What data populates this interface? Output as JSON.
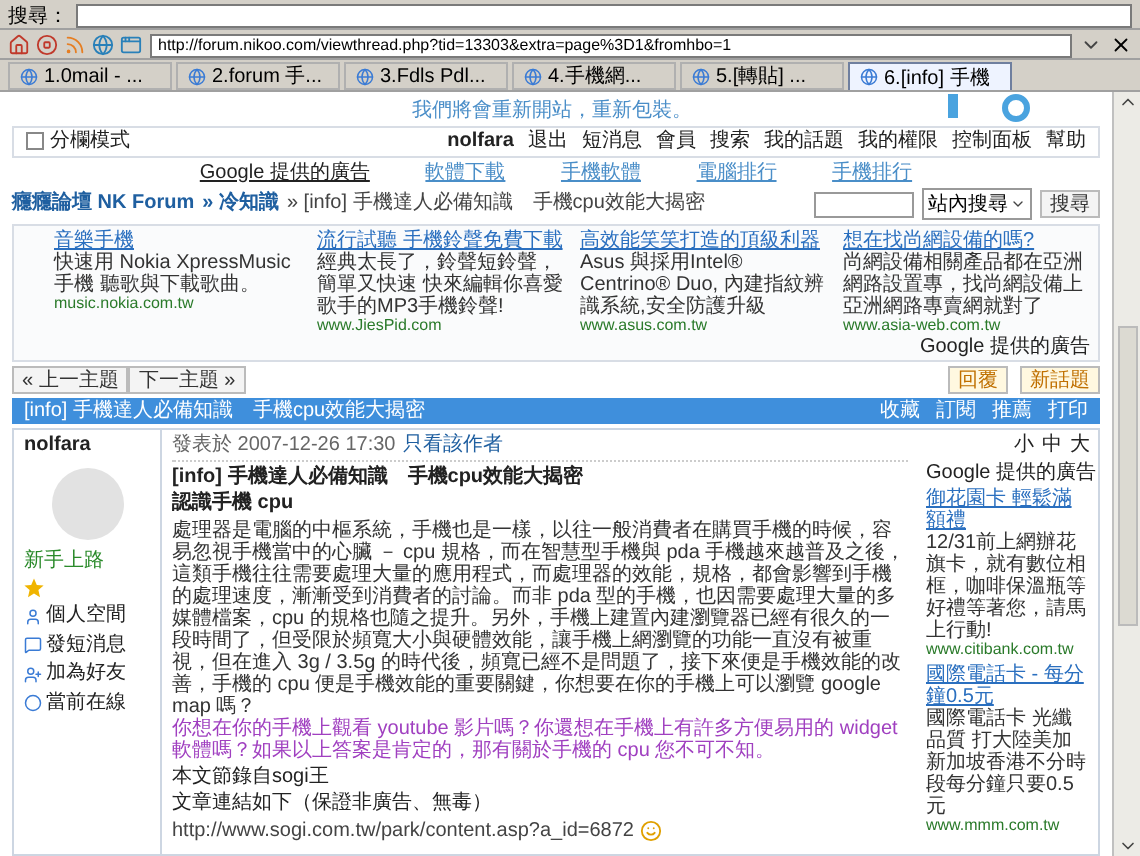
{
  "browser": {
    "search_label": "搜尋：",
    "address": "http://forum.nikoo.com/viewthread.php?tid=13303&extra=page%3D1&fromhbo=1",
    "tabs": [
      {
        "label": "1.0mail - ...",
        "selected": false
      },
      {
        "label": "2.forum 手...",
        "selected": false
      },
      {
        "label": "3.Fdls Pdl...",
        "selected": false
      },
      {
        "label": "4.手機網...",
        "selected": false
      },
      {
        "label": "5.[轉貼] ...",
        "selected": false
      },
      {
        "label": "6.[info] 手機",
        "selected": true
      }
    ]
  },
  "banner": {
    "text": "我們將會重新開站，重新包裝。"
  },
  "userbar": {
    "mode": {
      "label": "分欄模式",
      "checked": false
    },
    "user": "nolfara",
    "links": [
      "退出",
      "短消息",
      "會員",
      "搜索",
      "我的話題",
      "我的權限",
      "控制面板",
      "幫助"
    ]
  },
  "ad_links": [
    "Google 提供的廣告",
    "軟體下載",
    "手機軟體",
    "電腦排行",
    "手機排行"
  ],
  "breadcrumb": [
    "癮癮論壇 NK Forum",
    "» 冷知識",
    "» [info] 手機達人必備知識　手機cpu效能大揭密"
  ],
  "search": {
    "scope": "站內搜尋",
    "button": "搜尋"
  },
  "ads": [
    {
      "title": "音樂手機",
      "text": "快速用 Nokia XpressMusic 手機 聽歌與下載歌曲。",
      "url": "music.nokia.com.tw"
    },
    {
      "title": "流行試聽 手機鈴聲免費下載",
      "text": "經典太長了，鈴聲短鈴聲，簡單又快速 快來編輯你喜愛歌手的MP3手機鈴聲!",
      "url": "www.JiesPid.com"
    },
    {
      "title": "高效能笑笑打造的頂級利器",
      "text": "Asus 與採用Intel® Centrino® Duo, 內建指紋辨識系統,安全防護升級",
      "url": "www.asus.com.tw"
    },
    {
      "title": "想在找尚網設備的嗎?",
      "text": "尚網設備相關產品都在亞洲網路設置專，找尚網設備上亞洲網路專賣網就對了",
      "url": "www.asia-web.com.tw"
    }
  ],
  "ads_credit": "Google 提供的廣告",
  "thread_nav": {
    "prev": "« 上一主題",
    "next": "下一主題 »",
    "reply": "回覆",
    "new": "新話題"
  },
  "post": {
    "header": "[info] 手機達人必備知識　手機cpu效能大揭密",
    "actions": [
      "收藏",
      "訂閱",
      "推薦",
      "打印"
    ],
    "author": "nolfara",
    "date": "發表於 2007-12-26 17:30",
    "only_author": "只看該作者",
    "sizes": [
      "小",
      "中",
      "大"
    ],
    "rank": "新手上路",
    "profile_links": [
      "個人空間",
      "發短消息",
      "加為好友",
      "當前在線"
    ],
    "title": "[info] 手機達人必備知識　手機cpu效能大揭密",
    "subtitle": "認識手機 cpu",
    "body": "處理器是電腦的中樞系統，手機也是一樣，以往一般消費者在購買手機的時候，容易忽視手機當中的心臟 － cpu 規格，而在智慧型手機與 pda 手機越來越普及之後，這類手機往往需要處理大量的應用程式，而處理器的效能，規格，都會影響到手機的處理速度，漸漸受到消費者的討論。而非 pda 型的手機，也因需要處理大量的多媒體檔案，cpu 的規格也隨之提升。另外，手機上建置內建瀏覽器已經有很久的一段時間了，但受限於頻寬大小與硬體效能，讓手機上網瀏覽的功能一直沒有被重視，但在進入 3g / 3.5g 的時代後，頻寬已經不是問題了，接下來便是手機效能的改善，手機的 cpu 便是手機效能的重要關鍵，你想要在你的手機上可以瀏覽 google map 嗎？",
    "body_link": "你想在你的手機上觀看 youtube 影片嗎？你還想在手機上有許多方便易用的 widget 軟體嗎？如果以上答案是肯定的，那有關於手機的 cpu 您不可不知。",
    "source": "本文節錄自sogi王",
    "source_note": "文章連結如下（保證非廣告、無毒）",
    "link": "http://www.sogi.com.tw/park/content.asp?a_id=6872"
  },
  "side_ads": {
    "credit": "Google 提供的廣告",
    "items": [
      {
        "title": "御花園卡 輕鬆滿額禮",
        "text": "12/31前上網辦花旗卡，就有數位相框，咖啡保溫瓶等好禮等著您，請馬上行動!",
        "url": "www.citibank.com.tw"
      },
      {
        "title": "國際電話卡 - 每分鐘0.5元",
        "text": "國際電話卡 光纖品質 打大陸美加新加坡香港不分時段每分鐘只要0.5元",
        "url": "www.mmm.com.tw"
      }
    ]
  }
}
